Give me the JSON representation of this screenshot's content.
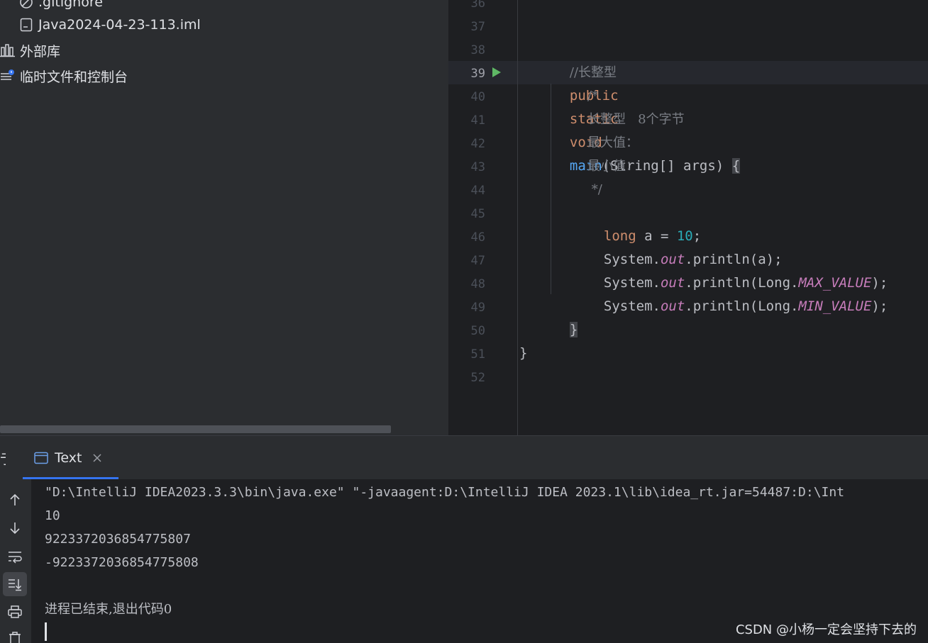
{
  "project_tree": {
    "items": [
      {
        "label": ".gitignore",
        "icon": "gitignore-icon"
      },
      {
        "label": "Java2024-04-23-113.iml",
        "icon": "iml-file-icon"
      },
      {
        "label": "外部库",
        "icon": "library-icon"
      },
      {
        "label": "临时文件和控制台",
        "icon": "scratches-icon"
      }
    ]
  },
  "editor": {
    "line_numbers": [
      "36",
      "37",
      "38",
      "39",
      "40",
      "41",
      "42",
      "43",
      "44",
      "45",
      "46",
      "47",
      "48",
      "49",
      "50",
      "51",
      "52"
    ],
    "current_line": "39",
    "code": {
      "l38_comment": "//长整型",
      "l39_public": "public",
      "l39_static": "static",
      "l39_void": "void",
      "l39_main": "main",
      "l39_params": "(String[] args) ",
      "l39_brace": "{",
      "l40": "/*",
      "l41": "长整型   8个字节",
      "l42": "最大值：",
      "l43": "最小值：",
      "l44": " */",
      "l45_kw": "long",
      "l45_mid": " a = ",
      "l45_num": "10",
      "l45_end": ";",
      "sys": "System.",
      "out": "out",
      "l46_tail": ".println(a);",
      "println_long": ".println(Long.",
      "max_value": "MAX_VALUE",
      "min_value": "MIN_VALUE",
      "close_call": ");",
      "l49_brace": "}",
      "l51_brace": "}"
    }
  },
  "run_tool": {
    "tab_label": "Text",
    "console": [
      "\"D:\\IntelliJ IDEA2023.3.3\\bin\\java.exe\" \"-javaagent:D:\\IntelliJ IDEA 2023.1\\lib\\idea_rt.jar=54487:D:\\Int",
      "10",
      "9223372036854775807",
      "-9223372036854775808",
      "",
      "进程已结束,退出代码0"
    ],
    "toolbar": [
      "up-arrow-icon",
      "down-arrow-icon",
      "soft-wrap-icon",
      "scroll-to-end-icon",
      "print-icon",
      "trash-icon"
    ]
  },
  "watermark": "CSDN @小杨一定会坚持下去的",
  "colors": {
    "keyword": "#cf8e6d",
    "function": "#56a8f5",
    "number": "#2aacb8",
    "static_field": "#c77dbb",
    "comment": "#7a7e85",
    "accent": "#3574f0"
  }
}
